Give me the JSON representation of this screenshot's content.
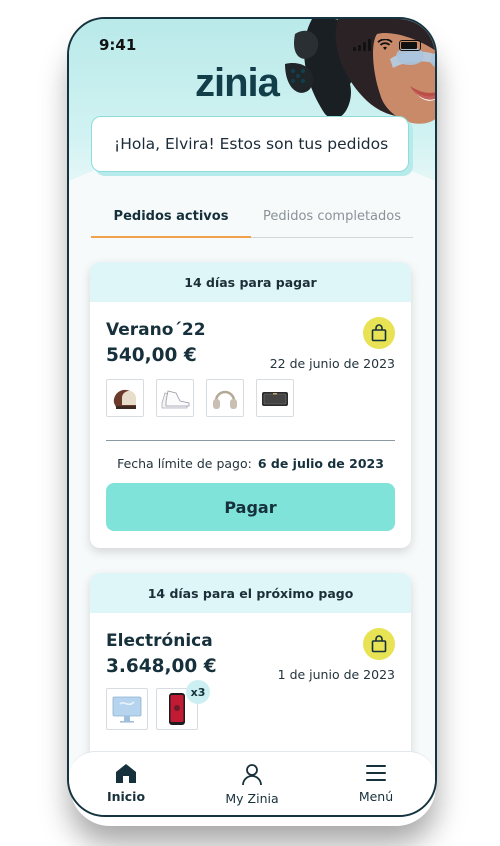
{
  "status_bar": {
    "time": "9:41"
  },
  "brand": {
    "logo_text": "zinia"
  },
  "greeting": "¡Hola, Elvira! Estos son tus pedidos",
  "tabs": [
    {
      "label": "Pedidos activos",
      "active": true
    },
    {
      "label": "Pedidos completados",
      "active": false
    }
  ],
  "orders": [
    {
      "header": "14 días para pagar",
      "name": "Verano´22",
      "amount": "540,00 €",
      "date": "22 de junio de 2023",
      "products": [
        "helmet-icon",
        "sneakers-icon",
        "headphones-icon",
        "speaker-icon"
      ],
      "deadline_label": "Fecha límite de pago:",
      "deadline_value": "6 de julio de 2023",
      "pay_label": "Pagar"
    },
    {
      "header": "14 días para el próximo pago",
      "name": "Electrónica",
      "amount": "3.648,00 €",
      "date": "1 de junio de 2023",
      "products": [
        "monitor-icon",
        "phone-icon"
      ],
      "phone_quantity": "x3"
    }
  ],
  "bottom_nav": [
    {
      "label": "Inicio",
      "icon": "home-icon",
      "active": true
    },
    {
      "label": "My Zinia",
      "icon": "user-icon",
      "active": false
    },
    {
      "label": "Menú",
      "icon": "menu-icon",
      "active": false
    }
  ],
  "colors": {
    "accent_teal": "#7fe3d9",
    "header_teal": "#b9e9e9",
    "card_header": "#def6f8",
    "bag_yellow": "#e7e354",
    "tab_underline": "#f0a24a",
    "dark_text": "#17313c"
  }
}
